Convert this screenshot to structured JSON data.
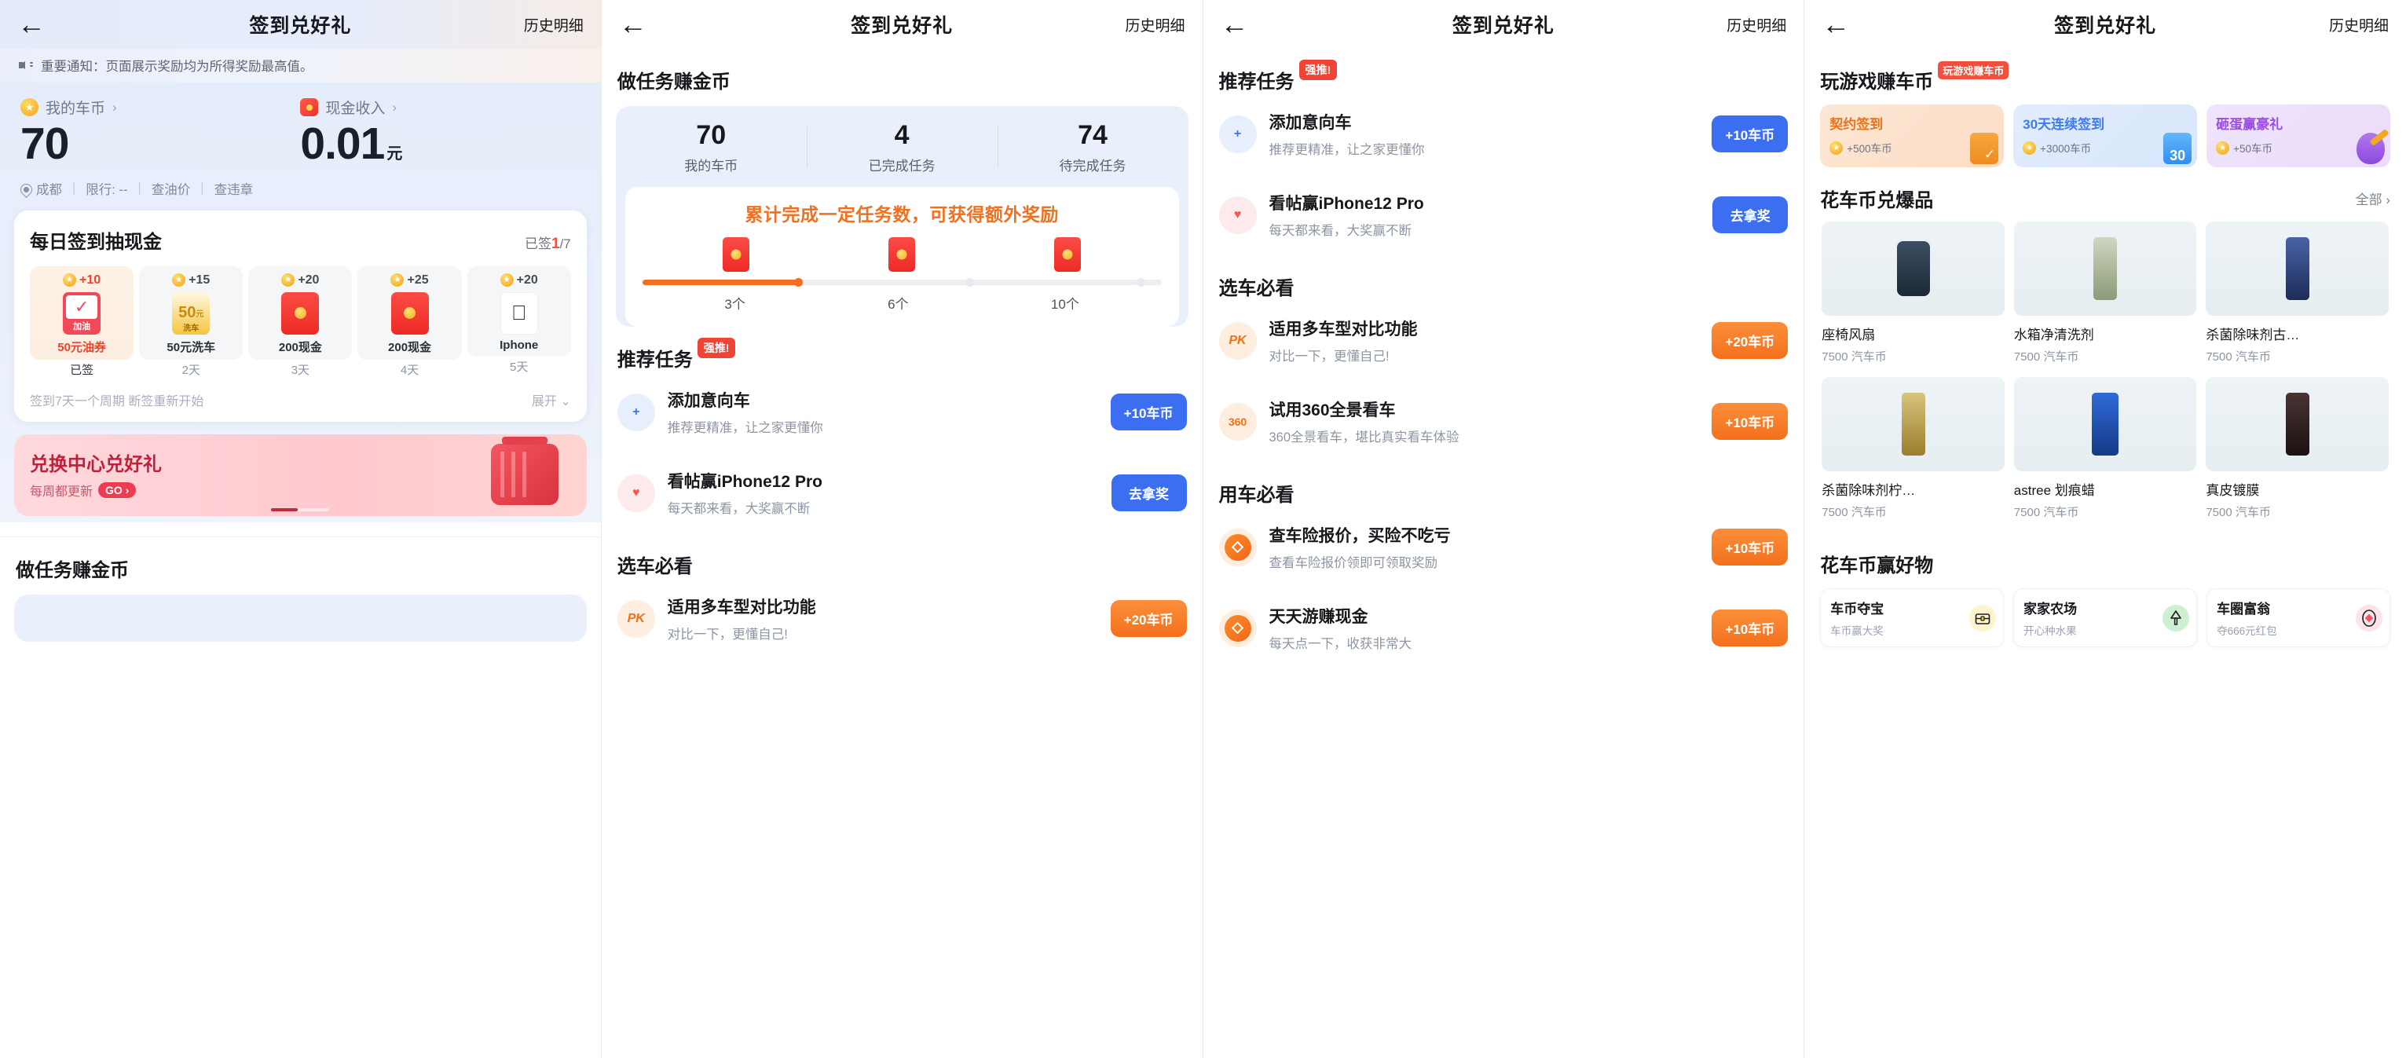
{
  "app": {
    "title": "签到兑好礼",
    "history_label": "历史明细",
    "back_icon": "arrow-left-icon"
  },
  "panel1": {
    "notice": "重要通知：页面展示奖励均为所得奖励最高值。",
    "notice_icon": "speaker-icon",
    "balance": {
      "coin_label": "我的车币",
      "coin_value": "70",
      "cash_label": "现金收入",
      "cash_value": "0.01",
      "cash_unit": "元",
      "chevron": "›"
    },
    "city_row": {
      "city": "成都",
      "limit": "限行: --",
      "oil": "查油价",
      "violation": "查违章"
    },
    "signin": {
      "title": "每日签到抽现金",
      "progress_prefix": "已签",
      "progress_value": "1",
      "progress_total": "/7",
      "days": [
        {
          "bonus": "+10",
          "title": "50元油券",
          "day": "已签",
          "thumb": "gas-coupon",
          "thumb_text": "加油",
          "active": true
        },
        {
          "bonus": "+15",
          "title": "50元洗车",
          "day": "2天",
          "thumb": "wash-coupon",
          "thumb_num": "50",
          "thumb_unit": "元",
          "thumb_text": "洗车",
          "active": false
        },
        {
          "bonus": "+20",
          "title": "200现金",
          "day": "3天",
          "thumb": "red-packet",
          "active": false
        },
        {
          "bonus": "+25",
          "title": "200现金",
          "day": "4天",
          "thumb": "red-packet",
          "active": false
        },
        {
          "bonus": "+20",
          "title": "Iphone",
          "day": "5天",
          "thumb": "apple-logo",
          "thumb_text": "",
          "active": false
        }
      ],
      "footer_note": "签到7天一个周期 断签重新开始",
      "expand_label": "展开",
      "expand_chevron": "⌄"
    },
    "banner": {
      "title": "兑换中心兑好礼",
      "subtitle": "每周都更新",
      "cta": "GO ›",
      "art": "suitcase-illustration"
    },
    "bottom_section_title": "做任务赚金币"
  },
  "panel2": {
    "section_title": "做任务赚金币",
    "stats": [
      {
        "num": "70",
        "label": "我的车币"
      },
      {
        "num": "4",
        "label": "已完成任务"
      },
      {
        "num": "74",
        "label": "待完成任务"
      }
    ],
    "promo": "累计完成一定任务数，可获得额外奖励",
    "milestones": [
      "3个",
      "6个",
      "10个"
    ],
    "progress_pct": 30,
    "rec_title": "推荐任务",
    "rec_tag": "强推!",
    "tasks": [
      {
        "icon": "car-plus-icon",
        "icon_style": "blue",
        "name": "添加意向车",
        "desc": "推荐更精准，让之家更懂你",
        "btn": "+10车币",
        "btn_style": "blue"
      },
      {
        "icon": "heart-plus-icon",
        "icon_style": "pink",
        "name": "看帖赢iPhone12 Pro",
        "desc": "每天都来看，大奖赢不断",
        "btn": "去拿奖",
        "btn_style": "blue"
      }
    ],
    "pick_title": "选车必看",
    "pick_tasks": [
      {
        "icon": "pk-icon",
        "icon_style": "org",
        "name": "适用多车型对比功能",
        "desc": "对比一下，更懂自己!",
        "btn": "+20车币",
        "btn_style": "org"
      }
    ]
  },
  "panel3": {
    "rec_title": "推荐任务",
    "rec_tag": "强推!",
    "tasks": [
      {
        "icon": "car-plus-icon",
        "icon_style": "blue",
        "name": "添加意向车",
        "desc": "推荐更精准，让之家更懂你",
        "btn": "+10车币",
        "btn_style": "blue"
      },
      {
        "icon": "heart-plus-icon",
        "icon_style": "pink",
        "name": "看帖赢iPhone12 Pro",
        "desc": "每天都来看，大奖赢不断",
        "btn": "去拿奖",
        "btn_style": "blue"
      }
    ],
    "pick_title": "选车必看",
    "pick_tasks": [
      {
        "icon": "pk-icon",
        "icon_style": "org",
        "name": "适用多车型对比功能",
        "desc": "对比一下，更懂自己!",
        "btn": "+20车币",
        "btn_style": "org"
      },
      {
        "icon": "360-icon",
        "icon_style": "org2",
        "name": "试用360全景看车",
        "desc": "360全景看车，堪比真实看车体验",
        "btn": "+10车币",
        "btn_style": "org"
      }
    ],
    "use_title": "用车必看",
    "use_tasks": [
      {
        "icon": "diamond-icon",
        "icon_style": "dia",
        "name": "查车险报价，买险不吃亏",
        "desc": "查看车险报价领即可领取奖励",
        "btn": "+10车币",
        "btn_style": "org"
      },
      {
        "icon": "diamond-icon",
        "icon_style": "dia",
        "name": "天天游赚现金",
        "desc": "每天点一下，收获非常大",
        "btn": "+10车币",
        "btn_style": "org"
      }
    ]
  },
  "panel4": {
    "game_title": "玩游戏赚车币",
    "game_tag": "玩游戏赚车币",
    "game_cards": [
      {
        "title": "契约签到",
        "reward": "+500车币",
        "art": "clipboard-check-icon"
      },
      {
        "title": "30天连续签到",
        "reward": "+3000车币",
        "art": "calendar-30-icon"
      },
      {
        "title": "砸蛋赢豪礼",
        "reward": "+50车币",
        "art": "egg-hammer-icon"
      }
    ],
    "shop_title": "花车币兑爆品",
    "shop_all": "全部",
    "shop_chevron": "›",
    "products": [
      {
        "name": "座椅风扇",
        "price": "7500 汽车币",
        "color": "#2b3b4d"
      },
      {
        "name": "水箱净清洗剂",
        "price": "7500 汽车币",
        "color": "#7d8f6e"
      },
      {
        "name": "杀菌除味剂古…",
        "price": "7500 汽车币",
        "color": "#2c3f74"
      },
      {
        "name": "杀菌除味剂柠…",
        "price": "7500 汽车币",
        "color": "#a58b3c"
      },
      {
        "name": "astree 划痕蜡",
        "price": "7500 汽车币",
        "color": "#1f4fa8"
      },
      {
        "name": "真皮镀膜",
        "price": "7500 汽车币",
        "color": "#2a1d1d"
      }
    ],
    "win_title": "花车币赢好物",
    "win_cards": [
      {
        "title": "车币夺宝",
        "sub": "车币赢大奖",
        "icon": "treasure-chest-icon"
      },
      {
        "title": "家家农场",
        "sub": "开心种水果",
        "icon": "tree-icon"
      },
      {
        "title": "车圈富翁",
        "sub": "夺666元红包",
        "icon": "diamond-ring-icon"
      }
    ]
  },
  "colors": {
    "blue": "#3b6ef0",
    "orange": "#f4701d",
    "red": "#ef4436",
    "coin": "#f5a623"
  }
}
